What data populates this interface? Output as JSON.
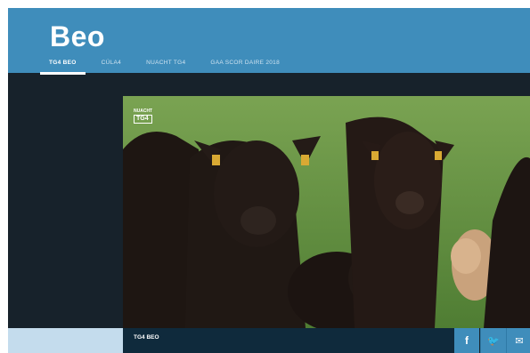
{
  "site": {
    "logo": "Beo"
  },
  "nav": {
    "tabs": [
      {
        "label": "TG4 BEO",
        "active": true
      },
      {
        "label": "CÚLA4",
        "active": false
      },
      {
        "label": "NUACHT TG4",
        "active": false
      },
      {
        "label": "GAA SCOR DAIRE 2018",
        "active": false
      }
    ]
  },
  "player": {
    "channel_logo_top": "NUACHT",
    "channel_logo": "TG4",
    "caption": "TG4 BEO"
  },
  "share": {
    "facebook_icon": "f",
    "twitter_icon": "🐦",
    "mail_icon": "✉"
  },
  "colors": {
    "header": "#3f8dbb",
    "background": "#17222b",
    "caption_bar": "#0f2a3c",
    "share_button": "#3f8dbb"
  }
}
